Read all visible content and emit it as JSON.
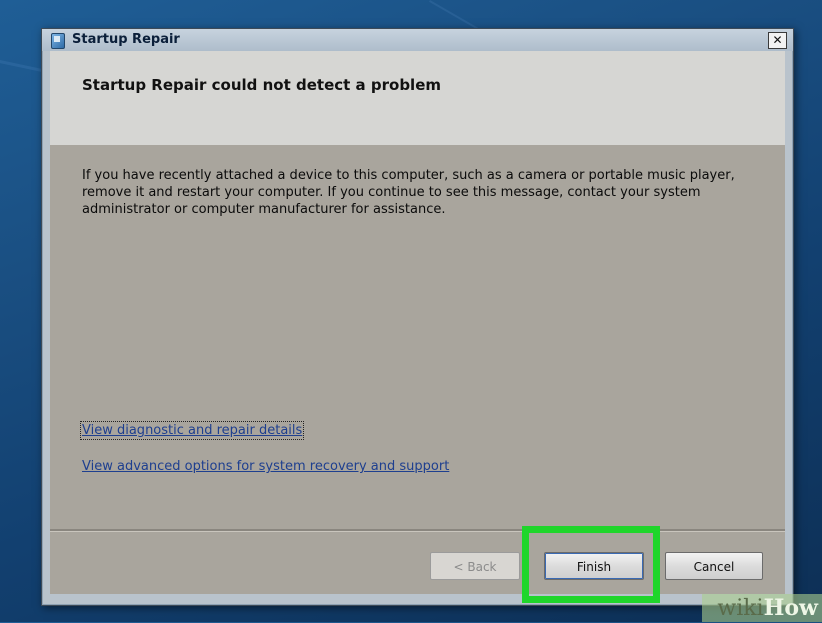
{
  "window": {
    "title": "Startup Repair",
    "close_glyph": "✕",
    "icon": "startup-repair-icon"
  },
  "header": {
    "title": "Startup Repair could not detect a problem"
  },
  "content": {
    "message": "If you have recently attached a device to this computer, such as a camera or portable music player, remove it and restart your computer. If you continue to see this message, contact your system administrator or computer manufacturer for assistance.",
    "links": [
      "View diagnostic and repair details",
      "View advanced options for system recovery and support"
    ]
  },
  "buttons": {
    "back": "< Back",
    "finish": "Finish",
    "cancel": "Cancel"
  },
  "annotation": {
    "highlight_color": "#1fd62b",
    "highlighted": "Finish"
  },
  "watermark": {
    "wiki": "wiki",
    "how": "How"
  }
}
